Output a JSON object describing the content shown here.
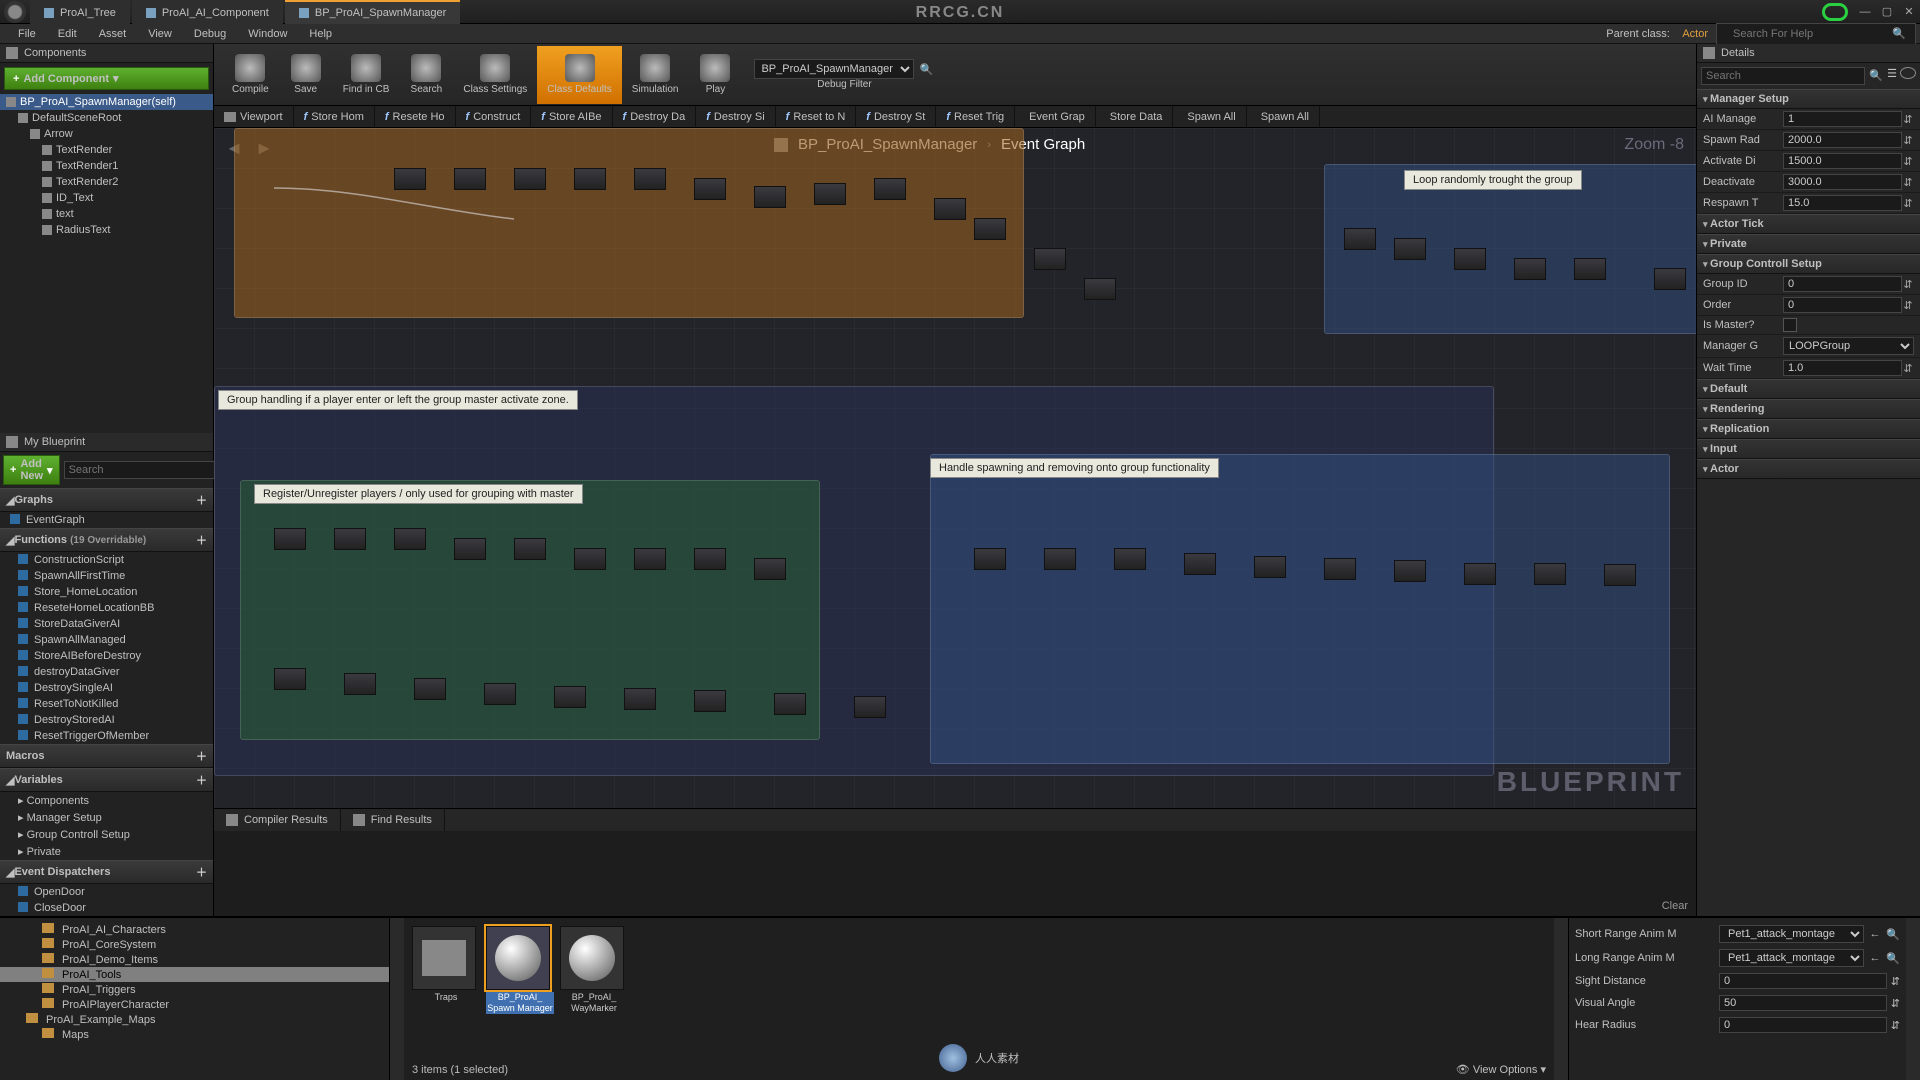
{
  "watermark_top": "RRCG.CN",
  "tabs": [
    {
      "label": "ProAI_Tree",
      "active": false
    },
    {
      "label": "ProAI_AI_Component",
      "active": false
    },
    {
      "label": "BP_ProAI_SpawnManager",
      "active": true
    }
  ],
  "menu": [
    "File",
    "Edit",
    "Asset",
    "View",
    "Debug",
    "Window",
    "Help"
  ],
  "parent_class_label": "Parent class:",
  "parent_class": "Actor",
  "search_help_placeholder": "Search For Help",
  "components": {
    "header": "Components",
    "add_btn": "Add Component",
    "items": [
      {
        "label": "BP_ProAI_SpawnManager(self)",
        "indent": 0,
        "sel": true
      },
      {
        "label": "DefaultSceneRoot",
        "indent": 1
      },
      {
        "label": "Arrow",
        "indent": 2
      },
      {
        "label": "TextRender",
        "indent": 3
      },
      {
        "label": "TextRender1",
        "indent": 3
      },
      {
        "label": "TextRender2",
        "indent": 3
      },
      {
        "label": "ID_Text",
        "indent": 3
      },
      {
        "label": "text",
        "indent": 3
      },
      {
        "label": "RadiusText",
        "indent": 3
      }
    ]
  },
  "myblueprint": {
    "header": "My Blueprint",
    "add_btn": "Add New",
    "search_placeholder": "Search",
    "sections": {
      "graphs": {
        "title": "Graphs",
        "items": [
          "EventGraph"
        ]
      },
      "functions": {
        "title": "Functions",
        "sub": "(19 Overridable)",
        "items": [
          "ConstructionScript",
          "SpawnAllFirstTime",
          "Store_HomeLocation",
          "ReseteHomeLocationBB",
          "StoreDataGiverAI",
          "SpawnAllManaged",
          "StoreAIBeforeDestroy",
          "destroyDataGiver",
          "DestroySingleAI",
          "ResetToNotKilled",
          "DestroyStoredAI",
          "ResetTriggerOfMember"
        ]
      },
      "macros": {
        "title": "Macros"
      },
      "variables": {
        "title": "Variables",
        "items": [
          "Components",
          "Manager Setup",
          "Group Controll Setup",
          "Private"
        ]
      },
      "dispatchers": {
        "title": "Event Dispatchers",
        "items": [
          "OpenDoor",
          "CloseDoor"
        ]
      }
    }
  },
  "toolbar": [
    {
      "label": "Compile"
    },
    {
      "label": "Save"
    },
    {
      "label": "Find in CB"
    },
    {
      "label": "Search"
    },
    {
      "label": "Class Settings"
    },
    {
      "label": "Class Defaults",
      "active": true
    },
    {
      "label": "Simulation"
    },
    {
      "label": "Play"
    }
  ],
  "debug_filter": {
    "label": "Debug Filter",
    "value": "BP_ProAI_SpawnManager"
  },
  "graph_tabs": [
    "Viewport",
    "Store Hom",
    "Resete Ho",
    "Construct",
    "Store AIBe",
    "Destroy Da",
    "Destroy Si",
    "Reset to N",
    "Destroy St",
    "Reset Trig",
    "Event Grap",
    "Store Data",
    "Spawn All",
    "Spawn All"
  ],
  "breadcrumb": {
    "root": "BP_ProAI_SpawnManager",
    "leaf": "Event Graph"
  },
  "zoom": "Zoom -8",
  "graph_comments": {
    "loop": "Loop randomly trought the group",
    "group_handle": "Group handling if a player enter or left the group master activate zone.",
    "register": "Register/Unregister players / only used for grouping with master",
    "spawn": "Handle spawning and removing onto group functionality"
  },
  "blueprint_wm": "BLUEPRINT",
  "results": {
    "tabs": [
      "Compiler Results",
      "Find Results"
    ],
    "clear": "Clear"
  },
  "details": {
    "header": "Details",
    "search_placeholder": "Search",
    "groups": [
      {
        "title": "Manager Setup",
        "rows": [
          {
            "lbl": "AI Manage",
            "val": "1",
            "type": "num"
          },
          {
            "lbl": "Spawn Rad",
            "val": "2000.0",
            "type": "num"
          },
          {
            "lbl": "Activate Di",
            "val": "1500.0",
            "type": "num"
          },
          {
            "lbl": "Deactivate",
            "val": "3000.0",
            "type": "num"
          },
          {
            "lbl": "Respawn T",
            "val": "15.0",
            "type": "num"
          }
        ]
      },
      {
        "title": "Actor Tick",
        "rows": []
      },
      {
        "title": "Private",
        "rows": []
      },
      {
        "title": "Group Controll Setup",
        "rows": [
          {
            "lbl": "Group ID",
            "val": "0",
            "type": "num"
          },
          {
            "lbl": "Order",
            "val": "0",
            "type": "num"
          },
          {
            "lbl": "Is Master?",
            "val": "",
            "type": "chk"
          },
          {
            "lbl": "Manager G",
            "val": "LOOPGroup",
            "type": "sel"
          },
          {
            "lbl": "Wait Time",
            "val": "1.0",
            "type": "num"
          }
        ]
      },
      {
        "title": "Default",
        "rows": []
      },
      {
        "title": "Rendering",
        "rows": []
      },
      {
        "title": "Replication",
        "rows": []
      },
      {
        "title": "Input",
        "rows": []
      },
      {
        "title": "Actor",
        "rows": []
      }
    ]
  },
  "content_browser": {
    "folders": [
      {
        "label": "ProAI_AI_Characters",
        "indent": 2
      },
      {
        "label": "ProAI_CoreSystem",
        "indent": 2
      },
      {
        "label": "ProAI_Demo_Items",
        "indent": 2
      },
      {
        "label": "ProAI_Tools",
        "indent": 2,
        "sel": true
      },
      {
        "label": "ProAI_Triggers",
        "indent": 2
      },
      {
        "label": "ProAIPlayerCharacter",
        "indent": 2
      },
      {
        "label": "ProAI_Example_Maps",
        "indent": 1
      },
      {
        "label": "Maps",
        "indent": 2
      }
    ],
    "assets": [
      {
        "name": "Traps",
        "type": "folder"
      },
      {
        "name": "BP_ProAI_ Spawn Manager",
        "type": "bp",
        "sel": true
      },
      {
        "name": "BP_ProAI_ WayMarker",
        "type": "bp"
      }
    ],
    "status": "3 items (1 selected)",
    "viewopts": "View Options",
    "right": [
      {
        "lbl": "Short Range Anim M",
        "val": "Pet1_attack_montage",
        "type": "sel",
        "extras": true
      },
      {
        "lbl": "Long Range Anim M",
        "val": "Pet1_attack_montage",
        "type": "sel",
        "extras": true
      },
      {
        "lbl": "Sight Distance",
        "val": "0",
        "type": "num"
      },
      {
        "lbl": "Visual Angle",
        "val": "50",
        "type": "num"
      },
      {
        "lbl": "Hear Radius",
        "val": "0",
        "type": "num"
      }
    ]
  },
  "bottom_wm": "人人素材"
}
